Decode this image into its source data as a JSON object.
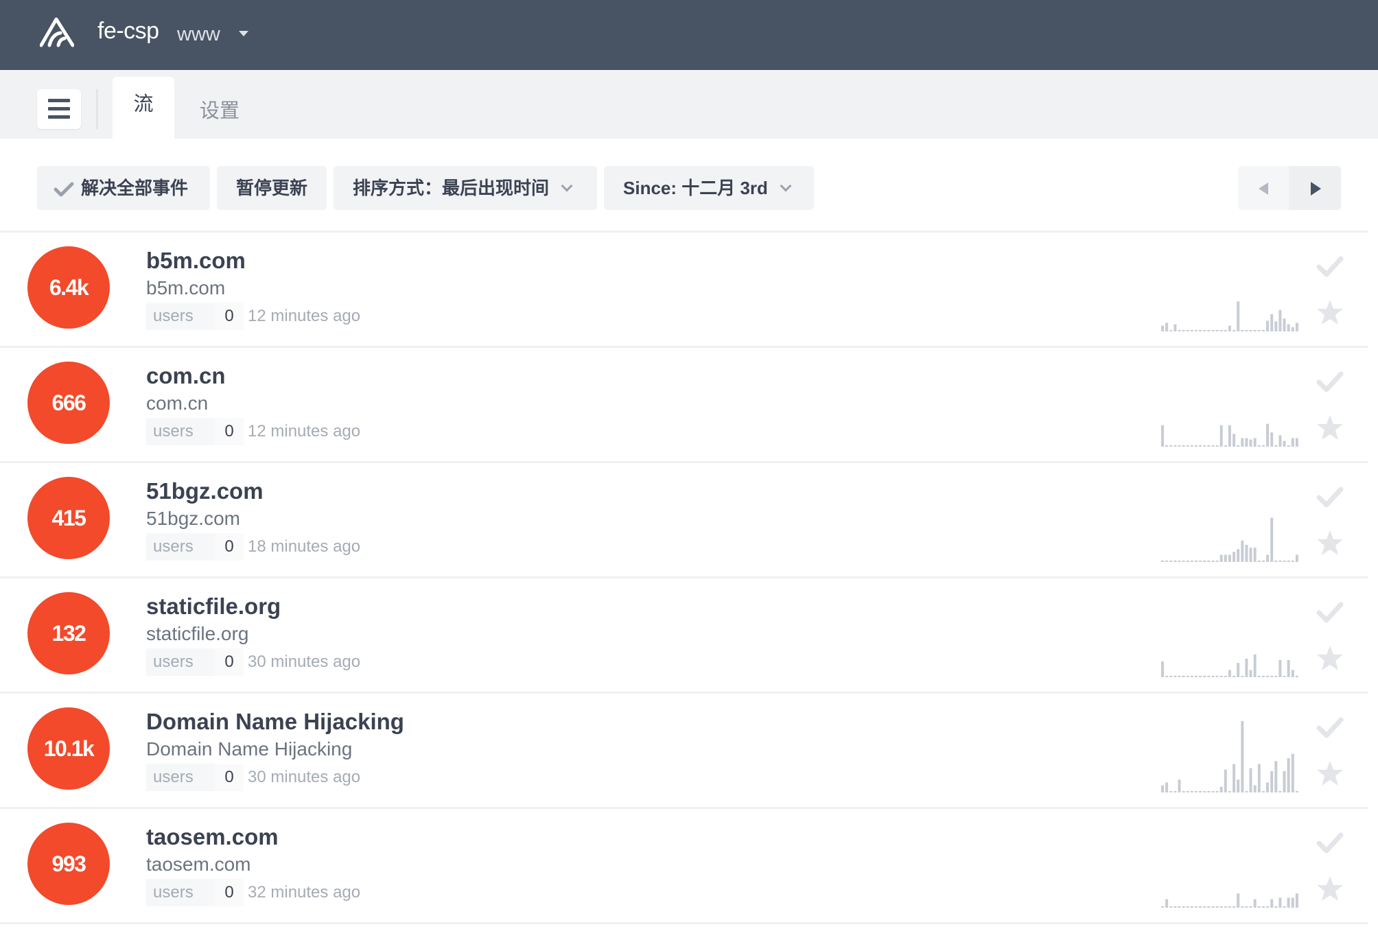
{
  "header": {
    "org": "fe-csp",
    "project": "www",
    "logo_icon": "sentry-logo-icon",
    "caret_icon": "caret-down-icon"
  },
  "tabs": {
    "menu_icon": "hamburger-menu-icon",
    "stream": "流",
    "settings": "设置"
  },
  "toolbar": {
    "resolve_all": "解决全部事件",
    "pause": "暂停更新",
    "sort": "排序方式：最后出现时间",
    "since": "Since: 十二月 3rd",
    "prev_icon": "previous-page-icon",
    "next_icon": "next-page-icon"
  },
  "colors": {
    "header_bg": "#485463",
    "count_badge": "#f24a2b",
    "spark_bar": "#c8ccd4"
  },
  "issues": [
    {
      "count": "6.4k",
      "title": "b5m.com",
      "subtitle": "b5m.com",
      "users_label": "users",
      "users": "0",
      "time": "12 minutes ago",
      "spark": [
        0.08,
        0.12,
        0,
        0.1,
        0.02,
        0.02,
        0.02,
        0.02,
        0.02,
        0.02,
        0.02,
        0.02,
        0.02,
        0.02,
        0.02,
        0.02,
        0.08,
        0.02,
        0.42,
        0.02,
        0.02,
        0.02,
        0.02,
        0.02,
        0.02,
        0.15,
        0.24,
        0.14,
        0.3,
        0.18,
        0.1,
        0.06,
        0.12
      ]
    },
    {
      "count": "666",
      "title": "com.cn",
      "subtitle": "com.cn",
      "users_label": "users",
      "users": "0",
      "time": "12 minutes ago",
      "spark": [
        0.3,
        0.02,
        0.02,
        0.02,
        0.02,
        0.02,
        0.02,
        0.02,
        0.02,
        0.02,
        0.02,
        0.02,
        0.02,
        0.02,
        0.3,
        0.02,
        0.3,
        0.18,
        0.02,
        0.12,
        0.12,
        0.1,
        0.12,
        0.02,
        0.02,
        0.32,
        0.2,
        0.02,
        0.16,
        0.08,
        0.02,
        0.12,
        0.12
      ]
    },
    {
      "count": "415",
      "title": "51bgz.com",
      "subtitle": "51bgz.com",
      "users_label": "users",
      "users": "0",
      "time": "18 minutes ago",
      "spark": [
        0.02,
        0.02,
        0.02,
        0.02,
        0.02,
        0.02,
        0.02,
        0.02,
        0.02,
        0.02,
        0.02,
        0.02,
        0.02,
        0.02,
        0.1,
        0.1,
        0.1,
        0.14,
        0.18,
        0.3,
        0.24,
        0.2,
        0.2,
        0.02,
        0.02,
        0.1,
        0.62,
        0.02,
        0.02,
        0.02,
        0.02,
        0.02,
        0.1
      ]
    },
    {
      "count": "132",
      "title": "staticfile.org",
      "subtitle": "staticfile.org",
      "users_label": "users",
      "users": "0",
      "time": "30 minutes ago",
      "spark": [
        0.22,
        0.02,
        0.02,
        0.02,
        0.02,
        0.02,
        0.02,
        0.02,
        0.02,
        0.02,
        0.02,
        0.02,
        0.02,
        0.02,
        0.02,
        0.02,
        0.1,
        0.02,
        0.2,
        0.02,
        0.26,
        0.1,
        0.32,
        0.02,
        0.02,
        0.02,
        0.02,
        0.02,
        0.24,
        0.02,
        0.24,
        0.1,
        0.02
      ]
    },
    {
      "count": "10.1k",
      "title": "Domain Name Hijacking",
      "subtitle": "Domain Name Hijacking",
      "users_label": "users",
      "users": "0",
      "time": "30 minutes ago",
      "spark": [
        0.1,
        0.14,
        0.02,
        0.02,
        0.18,
        0.02,
        0.02,
        0.02,
        0.02,
        0.02,
        0.02,
        0.02,
        0.02,
        0.02,
        0.08,
        0.32,
        0.02,
        0.4,
        0.18,
        1.0,
        0.02,
        0.34,
        0.1,
        0.4,
        0.02,
        0.14,
        0.3,
        0.44,
        0.02,
        0.3,
        0.48,
        0.54,
        0.02
      ]
    },
    {
      "count": "993",
      "title": "taosem.com",
      "subtitle": "taosem.com",
      "users_label": "users",
      "users": "0",
      "time": "32 minutes ago",
      "spark": [
        0.02,
        0.12,
        0.02,
        0.02,
        0.02,
        0.02,
        0.02,
        0.02,
        0.02,
        0.02,
        0.02,
        0.02,
        0.02,
        0.02,
        0.02,
        0.02,
        0.02,
        0.02,
        0.2,
        0.02,
        0.02,
        0.02,
        0.12,
        0.02,
        0.02,
        0.02,
        0.12,
        0.02,
        0.14,
        0.02,
        0.14,
        0.14,
        0.2
      ]
    }
  ]
}
